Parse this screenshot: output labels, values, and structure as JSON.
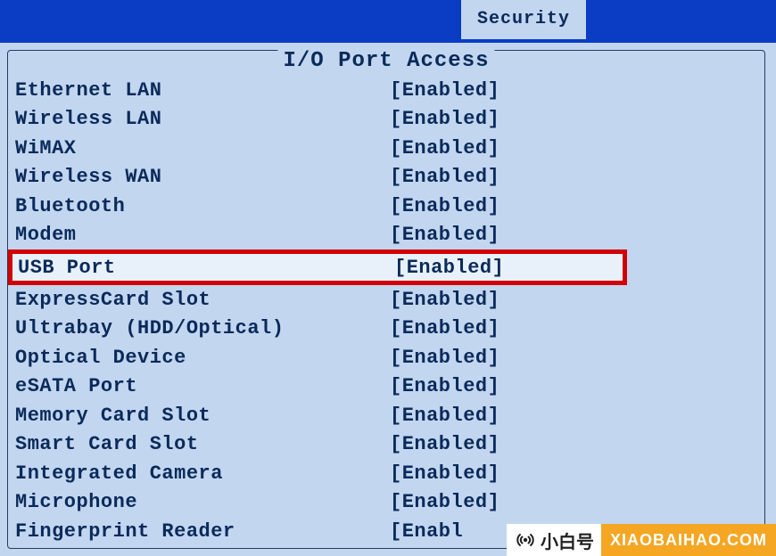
{
  "header": {
    "active_tab": "Security"
  },
  "panel": {
    "title": "I/O Port Access",
    "rows": [
      {
        "label": "Ethernet LAN",
        "value": "[Enabled]",
        "highlighted": false
      },
      {
        "label": "Wireless LAN",
        "value": "[Enabled]",
        "highlighted": false
      },
      {
        "label": "WiMAX",
        "value": "[Enabled]",
        "highlighted": false
      },
      {
        "label": "Wireless WAN",
        "value": "[Enabled]",
        "highlighted": false
      },
      {
        "label": "Bluetooth",
        "value": "[Enabled]",
        "highlighted": false
      },
      {
        "label": "Modem",
        "value": "[Enabled]",
        "highlighted": false
      },
      {
        "label": "USB Port",
        "value": "[Enabled]",
        "highlighted": true
      },
      {
        "label": "ExpressCard Slot",
        "value": "[Enabled]",
        "highlighted": false
      },
      {
        "label": "Ultrabay (HDD/Optical)",
        "value": "[Enabled]",
        "highlighted": false
      },
      {
        "label": "Optical Device",
        "value": "[Enabled]",
        "highlighted": false
      },
      {
        "label": "eSATA Port",
        "value": "[Enabled]",
        "highlighted": false
      },
      {
        "label": "Memory Card Slot",
        "value": "[Enabled]",
        "highlighted": false
      },
      {
        "label": "Smart Card Slot",
        "value": "[Enabled]",
        "highlighted": false
      },
      {
        "label": "Integrated Camera",
        "value": "[Enabled]",
        "highlighted": false
      },
      {
        "label": "Microphone",
        "value": "[Enabled]",
        "highlighted": false
      },
      {
        "label": "Fingerprint Reader",
        "value": "[Enabl",
        "highlighted": false
      }
    ]
  },
  "watermark": {
    "brand": "小白号",
    "domain": "XIAOBAIHAO.COM"
  }
}
